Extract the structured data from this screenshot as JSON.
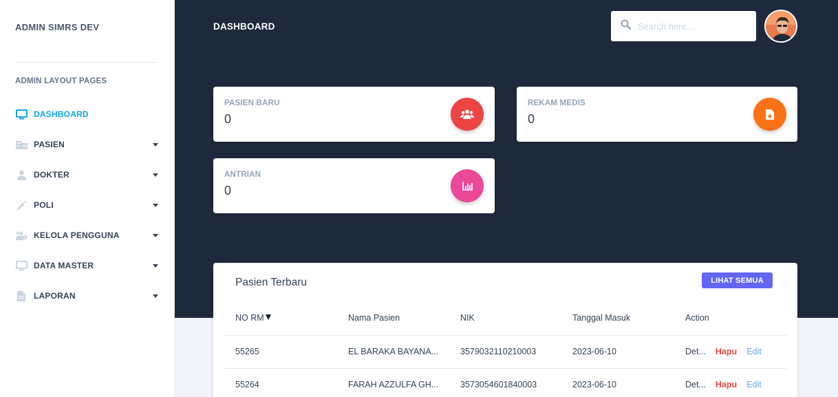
{
  "sidebar": {
    "brand": "ADMIN SIMRS DEV",
    "heading": "ADMIN LAYOUT PAGES",
    "items": [
      {
        "label": "DASHBOARD",
        "icon": "monitor-icon",
        "active": true
      },
      {
        "label": "PASIEN",
        "icon": "building-icon"
      },
      {
        "label": "DOKTER",
        "icon": "user-icon"
      },
      {
        "label": "POLI",
        "icon": "syringe-icon"
      },
      {
        "label": "KELOLA PENGGUNA",
        "icon": "users-cog-icon"
      },
      {
        "label": "DATA MASTER",
        "icon": "monitor-icon"
      },
      {
        "label": "LAPORAN",
        "icon": "file-icon"
      }
    ]
  },
  "header": {
    "title": "DASHBOARD",
    "search_placeholder": "Search here..."
  },
  "stats": [
    {
      "label": "PASIEN BARU",
      "value": "0",
      "icon": "users-icon",
      "color": "#ef4444"
    },
    {
      "label": "REKAM MEDIS",
      "value": "0",
      "icon": "file-medical-icon",
      "color": "#f97316"
    },
    {
      "label": "ANTRIAN",
      "value": "0",
      "icon": "chart-bar-icon",
      "color": "#ec4899"
    }
  ],
  "table": {
    "title": "Pasien Terbaru",
    "see_all": "LIHAT SEMUA",
    "columns": [
      "NO RM",
      "Nama Pasien",
      "NIK",
      "Tanggal Masuk",
      "Action"
    ],
    "rows": [
      {
        "no_rm": "55265",
        "nama": "EL BARAKA BAYANA...",
        "nik": "3579032110210003",
        "tanggal": "2023-06-10",
        "detail": "Det...",
        "hapus": "Hapu",
        "edit": "Edit"
      },
      {
        "no_rm": "55264",
        "nama": "FARAH AZZULFA GH...",
        "nik": "3573054601840003",
        "tanggal": "2023-06-10",
        "detail": "Det...",
        "hapus": "Hapu",
        "edit": "Edit"
      }
    ]
  },
  "colors": {
    "accent": "#0ea5e9",
    "header_bg": "#1e293b",
    "button": "#6366f1"
  }
}
